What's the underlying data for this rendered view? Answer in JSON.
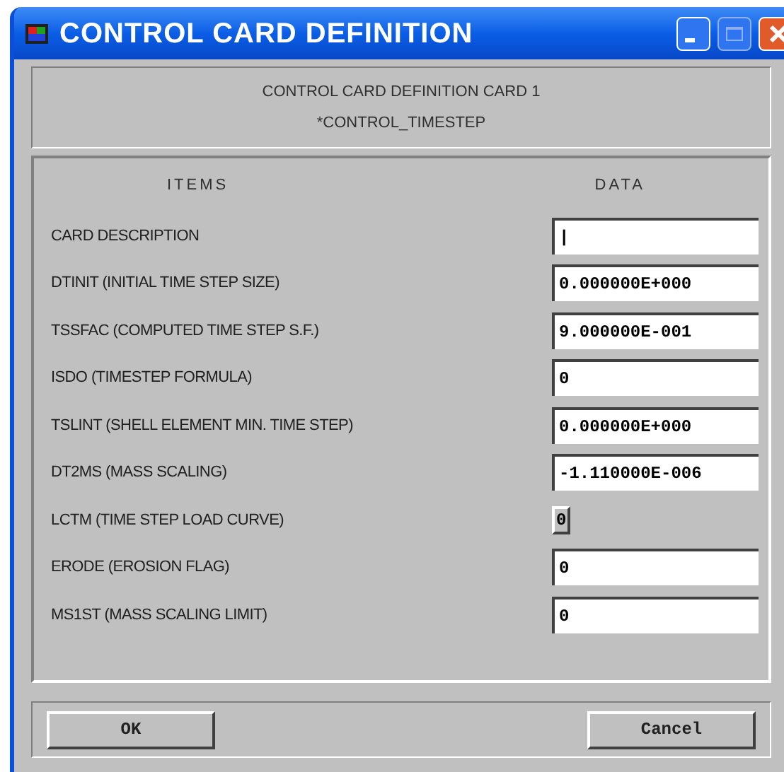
{
  "window": {
    "title": "CONTROL CARD DEFINITION"
  },
  "header": {
    "line_1": "CONTROL CARD DEFINITION CARD 1",
    "line_2": "*CONTROL_TIMESTEP"
  },
  "columns": {
    "items": "ITEMS",
    "data": "DATA"
  },
  "rows": [
    {
      "label": "CARD DESCRIPTION",
      "kind": "field",
      "value": "|"
    },
    {
      "label": "DTINIT (INITIAL TIME STEP SIZE)",
      "kind": "field",
      "value": "0.000000E+000"
    },
    {
      "label": "TSSFAC (COMPUTED TIME STEP S.F.)",
      "kind": "field",
      "value": "9.000000E-001"
    },
    {
      "label": "ISDO (TIMESTEP FORMULA)",
      "kind": "field",
      "value": "0"
    },
    {
      "label": "TSLINT (SHELL ELEMENT MIN. TIME STEP)",
      "kind": "field",
      "value": "0.000000E+000"
    },
    {
      "label": "DT2MS (MASS SCALING)",
      "kind": "field",
      "value": "-1.110000E-006"
    },
    {
      "label": "LCTM (TIME STEP LOAD CURVE)",
      "kind": "button",
      "value": "0"
    },
    {
      "label": "ERODE (EROSION FLAG)",
      "kind": "field",
      "value": "0"
    },
    {
      "label": "MS1ST (MASS SCALING LIMIT)",
      "kind": "field",
      "value": "0"
    }
  ],
  "buttons": [
    "OK",
    "Cancel"
  ]
}
